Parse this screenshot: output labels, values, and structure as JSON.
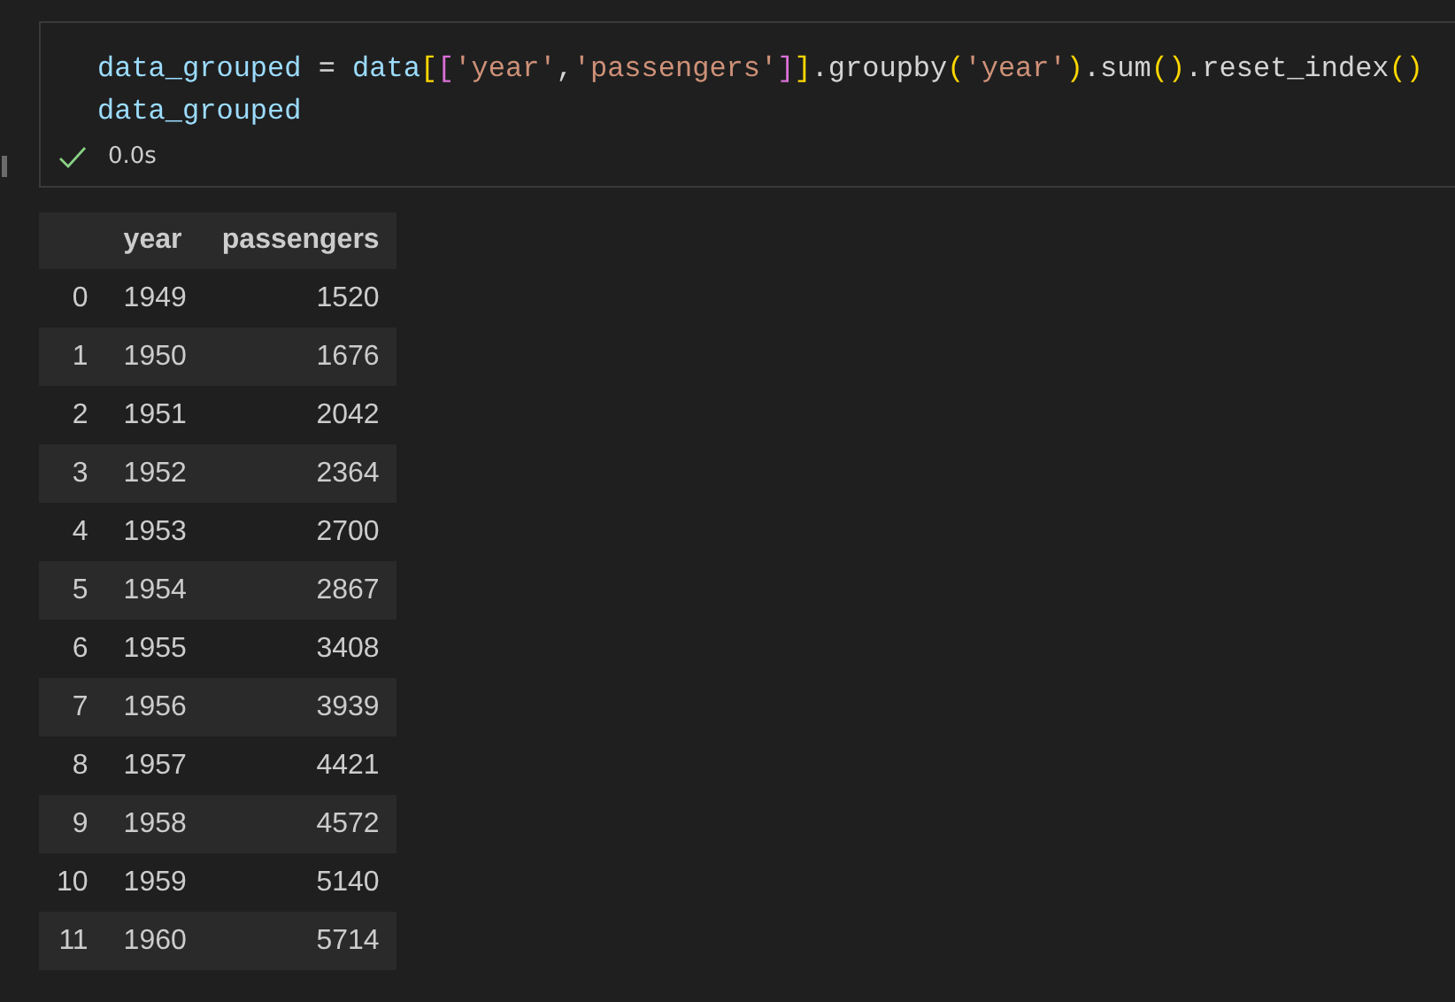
{
  "cell": {
    "code_lines": [
      [
        {
          "kind": "variable",
          "text": "data_grouped"
        },
        {
          "kind": "plain",
          "text": " = "
        },
        {
          "kind": "variable",
          "text": "data"
        },
        {
          "kind": "bracket1",
          "text": "["
        },
        {
          "kind": "bracket2",
          "text": "["
        },
        {
          "kind": "string",
          "text": "'year'"
        },
        {
          "kind": "plain",
          "text": ","
        },
        {
          "kind": "string",
          "text": "'passengers'"
        },
        {
          "kind": "bracket2",
          "text": "]"
        },
        {
          "kind": "bracket1",
          "text": "]"
        },
        {
          "kind": "plain",
          "text": ".groupby"
        },
        {
          "kind": "bracket1",
          "text": "("
        },
        {
          "kind": "string",
          "text": "'year'"
        },
        {
          "kind": "bracket1",
          "text": ")"
        },
        {
          "kind": "plain",
          "text": ".sum"
        },
        {
          "kind": "bracket1",
          "text": "()"
        },
        {
          "kind": "plain",
          "text": ".reset_index"
        },
        {
          "kind": "bracket1",
          "text": "()"
        }
      ],
      [
        {
          "kind": "variable",
          "text": "data_grouped"
        }
      ]
    ],
    "succeeded": true,
    "duration": "0.0s"
  },
  "table": {
    "columns": [
      "",
      "year",
      "passengers"
    ],
    "rows": [
      [
        "0",
        "1949",
        "1520"
      ],
      [
        "1",
        "1950",
        "1676"
      ],
      [
        "2",
        "1951",
        "2042"
      ],
      [
        "3",
        "1952",
        "2364"
      ],
      [
        "4",
        "1953",
        "2700"
      ],
      [
        "5",
        "1954",
        "2867"
      ],
      [
        "6",
        "1955",
        "3408"
      ],
      [
        "7",
        "1956",
        "3939"
      ],
      [
        "8",
        "1957",
        "4421"
      ],
      [
        "9",
        "1958",
        "4572"
      ],
      [
        "10",
        "1959",
        "5140"
      ],
      [
        "11",
        "1960",
        "5714"
      ]
    ]
  }
}
